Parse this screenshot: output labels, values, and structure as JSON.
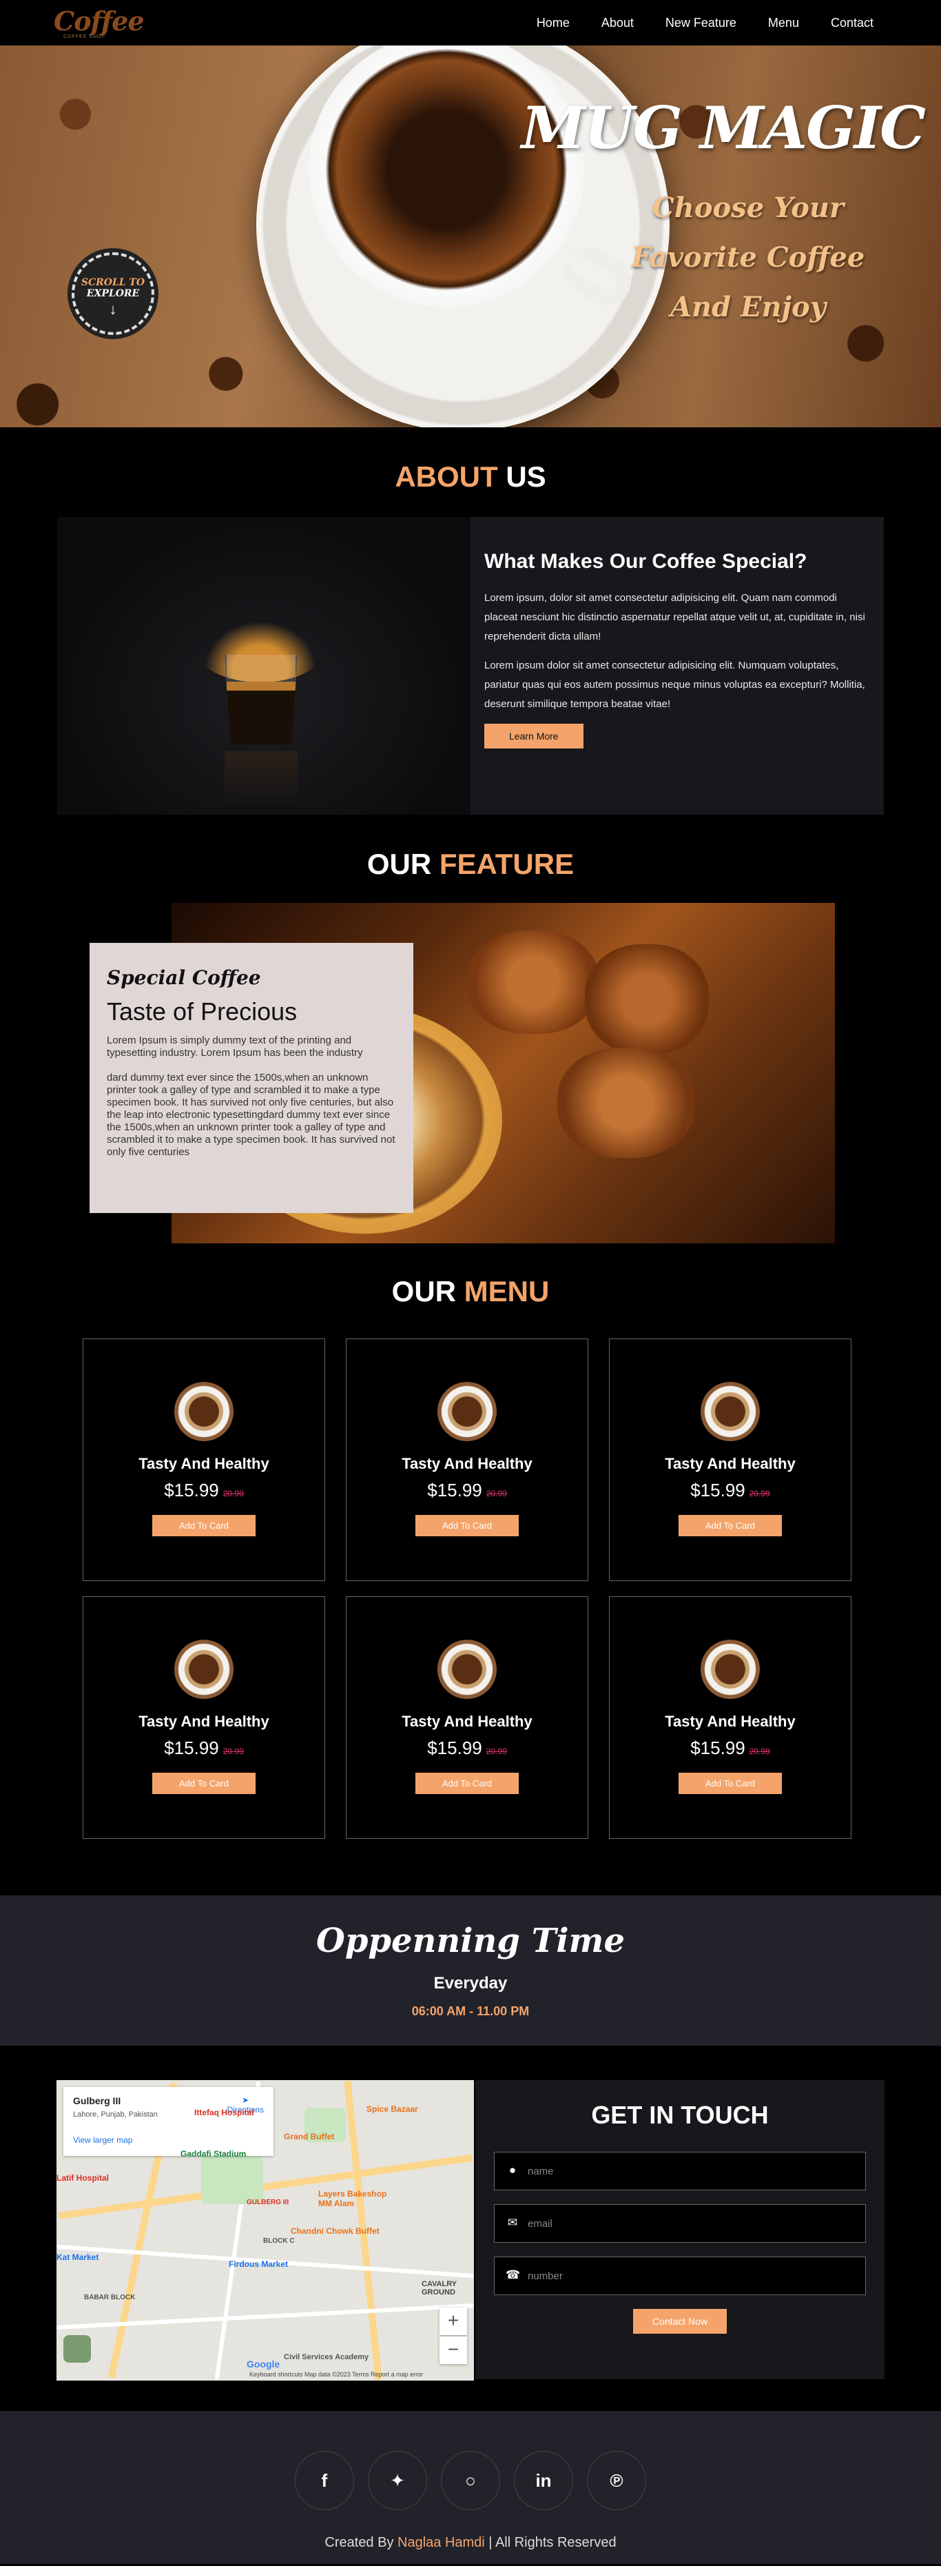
{
  "brand": {
    "logo_text": "Coffee",
    "logo_tagline": "COFFEE SHOP"
  },
  "nav": {
    "items": [
      "Home",
      "About",
      "New Feature",
      "Menu",
      "Contact"
    ]
  },
  "hero": {
    "title": "MUG MAGIC",
    "subtitle": "Choose Your Favorite Coffee And Enjoy",
    "scroll_line1": "SCROLL TO",
    "scroll_line2": "EXPLORE",
    "scroll_arrow": "↓"
  },
  "about": {
    "title_accent": "ABOUT",
    "title_rest": " US",
    "heading": "What Makes Our Coffee Special?",
    "para1": "Lorem ipsum, dolor sit amet consectetur adipisicing elit. Quam nam commodi placeat nesciunt hic distinctio aspernatur repellat atque velit ut, at, cupiditate in, nisi reprehenderit dicta ullam!",
    "para2": "Lorem ipsum dolor sit amet consectetur adipisicing elit. Numquam voluptates, pariatur quas qui eos autem possimus neque minus voluptas ea excepturi? Mollitia, deserunt similique tempora beatae vitae!",
    "button": "Learn More"
  },
  "feature": {
    "title_rest": "OUR ",
    "title_accent": "FEATURE",
    "kicker": "Special Coffee",
    "heading": "Taste of Precious",
    "para1": "Lorem Ipsum is simply dummy text of the printing and typesetting industry. Lorem Ipsum has been the industry",
    "para2": "dard dummy text ever since the 1500s,when an unknown printer took a galley of type and scrambled it to make a type specimen book. It has survived not only five centuries, but also the leap into electronic typesettingdard dummy text ever since the 1500s,when an unknown printer took a galley of type and scrambled it to make a type specimen book. It has survived not only five centuries"
  },
  "menu": {
    "title_rest": "OUR ",
    "title_accent": "MENU",
    "items": [
      {
        "name": "Tasty And Healthy",
        "price": "$15.99",
        "old_price": "20.99",
        "button": "Add To Card"
      },
      {
        "name": "Tasty And Healthy",
        "price": "$15.99",
        "old_price": "20.99",
        "button": "Add To Card"
      },
      {
        "name": "Tasty And Healthy",
        "price": "$15.99",
        "old_price": "20.99",
        "button": "Add To Card"
      },
      {
        "name": "Tasty And Healthy",
        "price": "$15.99",
        "old_price": "20.99",
        "button": "Add To Card"
      },
      {
        "name": "Tasty And Healthy",
        "price": "$15.99",
        "old_price": "20.99",
        "button": "Add To Card"
      },
      {
        "name": "Tasty And Healthy",
        "price": "$15.99",
        "old_price": "20.99",
        "button": "Add To Card"
      }
    ]
  },
  "hours": {
    "title": "Oppenning Time",
    "day": "Everyday",
    "time": "06:00 AM - 11.00 PM"
  },
  "map": {
    "place": "Gulberg III",
    "region": "Lahore, Punjab, Pakistan",
    "larger_map": "View larger map",
    "directions": "Directions",
    "labels": [
      "Grand Buffet",
      "Spice Bazaar",
      "Gaddafi Stadium",
      "Ittefaq Hospital",
      "Latif Hospital",
      "Layers Bakeshop MM Alam",
      "Chandni Chowk Buffet",
      "Firdous Market",
      "GULBERG III",
      "BLOCK C",
      "CAVALRY GROUND",
      "BABAR BLOCK",
      "Civil Services Academy",
      "Kat Market"
    ],
    "footer": "Keyboard shortcuts   Map data ©2023   Terms   Report a map error",
    "zoom_in": "+",
    "zoom_out": "−"
  },
  "contact": {
    "title": "GET IN TOUCH",
    "name_placeholder": "name",
    "email_placeholder": "email",
    "number_placeholder": "number",
    "button": "Contact Now"
  },
  "footer": {
    "socials": [
      "facebook-icon",
      "twitter-icon",
      "instagram-icon",
      "linkedin-icon",
      "pinterest-icon"
    ],
    "credit_prefix": "Created By ",
    "credit_name": "Naglaa Hamdi",
    "credit_suffix": " | All Rights Reserved"
  },
  "colors": {
    "accent": "#f4a46a",
    "panel": "#17171c",
    "band": "#22222a"
  }
}
